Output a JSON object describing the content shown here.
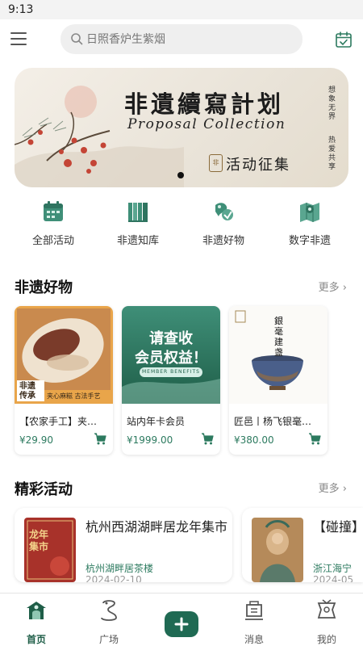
{
  "status_bar": {
    "time": "9:13"
  },
  "search": {
    "placeholder": "日照香炉生紫烟"
  },
  "banner": {
    "title": "非遺續寫計划",
    "subtitle": "Proposal Collection",
    "vertical_left": "想象无界",
    "vertical_right": "热爱共享",
    "seal": "非",
    "tag": "活动征集"
  },
  "quick_nav": [
    {
      "label": "全部活动",
      "icon": "calendar-icon"
    },
    {
      "label": "非遗知库",
      "icon": "books-icon"
    },
    {
      "label": "非遗好物",
      "icon": "goods-icon"
    },
    {
      "label": "数字非遗",
      "icon": "map-icon"
    }
  ],
  "sections": {
    "goods": {
      "title": "非遗好物",
      "more": "更多"
    },
    "activities": {
      "title": "精彩活动",
      "more": "更多"
    }
  },
  "products": [
    {
      "name": "【农家手工】夹心麻糍",
      "price": "¥29.90",
      "badge_main": "非遗传承",
      "badge_sub": "夹心麻糍 古法手艺"
    },
    {
      "name": "站内年卡会员",
      "price": "¥1999.00",
      "promo_line1": "请查收",
      "promo_line2": "会员权益！",
      "promo_en": "MEMBER BENEFITS"
    },
    {
      "name": "匠邑丨杨飞银毫建盏",
      "price": "¥380.00",
      "calligraphy": "銀毫建盏"
    }
  ],
  "activities": [
    {
      "title": "杭州西湖湖畔居龙年集市",
      "place": "杭州湖畔居茶楼",
      "date": "2024-02-10",
      "poster_text": "龙年集市"
    },
    {
      "title": "【碰撞】数字光影",
      "place": "浙江海宁",
      "date": "2024-05"
    }
  ],
  "bottom_nav": [
    {
      "label": "首页",
      "icon": "home-icon",
      "active": true
    },
    {
      "label": "广场",
      "icon": "plaza-icon",
      "active": false
    },
    {
      "label": "消息",
      "icon": "message-icon",
      "active": false
    },
    {
      "label": "我的",
      "icon": "profile-icon",
      "active": false
    }
  ],
  "colors": {
    "accent": "#1f6a53",
    "price": "#2c7a5f",
    "icon_green": "#3f8f78"
  }
}
